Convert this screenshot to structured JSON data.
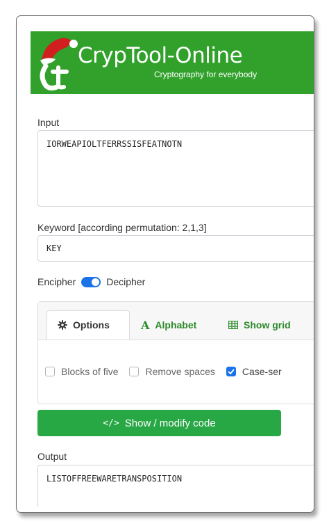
{
  "header": {
    "brand": "CrypTool-Online",
    "tagline": "Cryptography for everybody"
  },
  "input": {
    "label": "Input",
    "value": "IORWEAPIOLTFERRSSISFEATNOTN"
  },
  "keyword": {
    "label": "Keyword [according permutation: 2,1,3]",
    "value": "KEY"
  },
  "mode": {
    "encipher_label": "Encipher",
    "decipher_label": "Decipher",
    "selected": "Decipher"
  },
  "tabs": [
    {
      "label": "Options",
      "icon": "gear-icon"
    },
    {
      "label": "Alphabet",
      "icon": "letter-a-icon"
    },
    {
      "label": "Show grid",
      "icon": "table-icon"
    }
  ],
  "options": {
    "blocks_of_five": {
      "label": "Blocks of five",
      "checked": false
    },
    "remove_spaces": {
      "label": "Remove spaces",
      "checked": false
    },
    "case_sensitive": {
      "label": "Case-ser",
      "checked": true
    }
  },
  "code_button": {
    "label": "Show / modify code",
    "icon": "code-icon"
  },
  "output": {
    "label": "Output",
    "value": "LISTOFFREEWARETRANSPOSITION"
  },
  "colors": {
    "header_green": "#31a12c",
    "button_green": "#28a745",
    "accent_blue": "#1a73e8",
    "tab_green": "#2a8a2a"
  }
}
